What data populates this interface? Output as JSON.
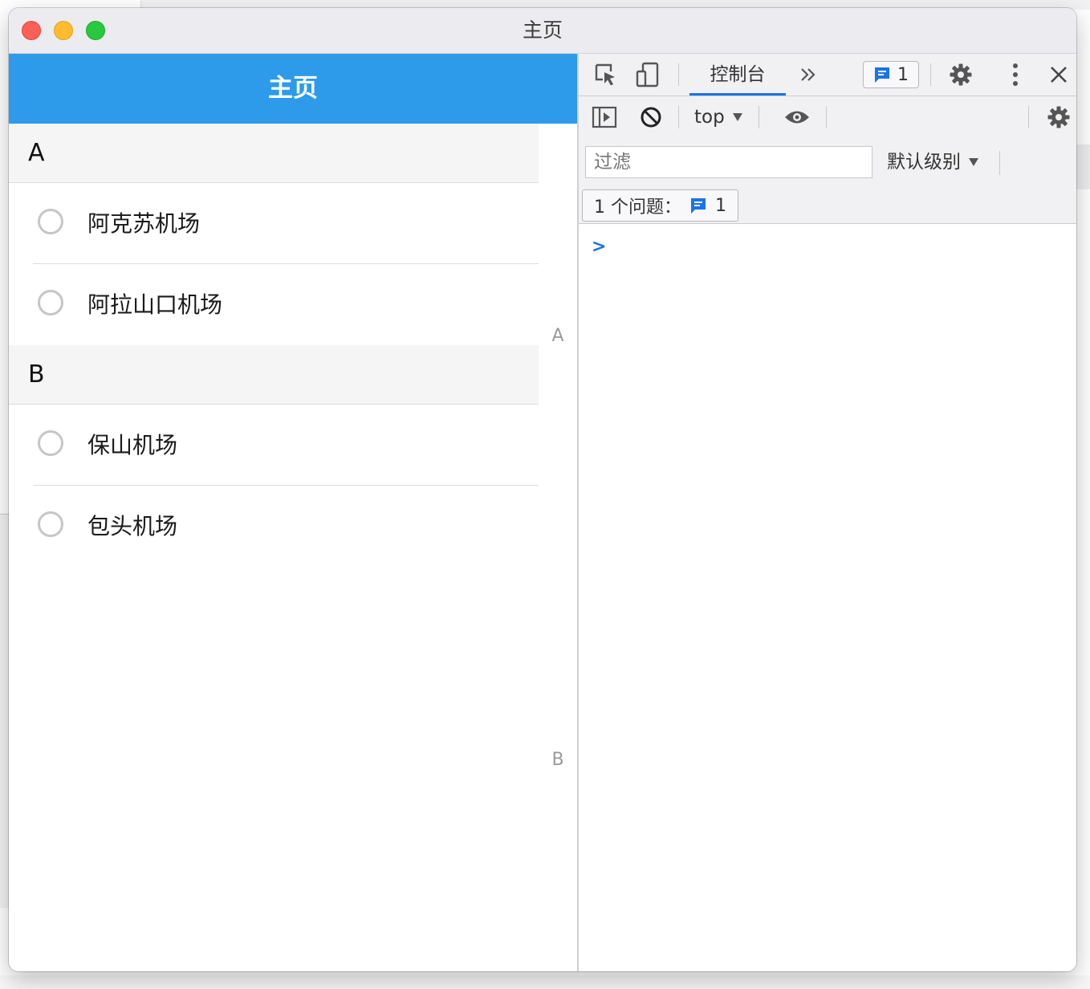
{
  "window": {
    "title": "主页"
  },
  "app": {
    "navbar_title": "主页",
    "sections": [
      {
        "letter": "A",
        "items": [
          "阿克苏机场",
          "阿拉山口机场"
        ]
      },
      {
        "letter": "B",
        "items": [
          "保山机场",
          "包头机场"
        ]
      }
    ],
    "index_bar": [
      "A",
      "B"
    ]
  },
  "devtools": {
    "toolbar": {
      "console_tab_label": "控制台",
      "more_tabs_icon": "chevron-double-right-icon",
      "issues_badge_count": "1"
    },
    "console_toolbar": {
      "context_label": "top"
    },
    "filter": {
      "placeholder": "过滤",
      "level_label": "默认级别"
    },
    "issues_bar": {
      "label": "1 个问题：",
      "count": "1"
    },
    "prompt_symbol": ">"
  },
  "colors": {
    "navbar": "#2d9be9",
    "accent": "#1a73e8"
  }
}
